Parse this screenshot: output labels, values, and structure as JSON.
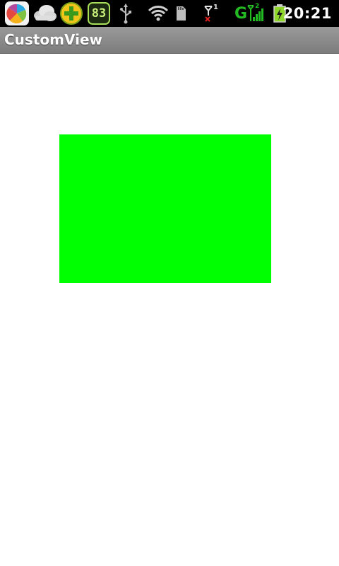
{
  "status_bar": {
    "time": "20:21",
    "notification_icons": [
      "pinwheel-app-icon",
      "cloud-weather-icon",
      "plus-app-icon",
      "counter-83-icon"
    ],
    "counter_value": "83",
    "system_icons": [
      "usb-icon",
      "wifi-icon",
      "sd-card-icon",
      "signal-off-icon",
      "gprs-signal-icon",
      "battery-charging-icon"
    ],
    "network_type": "G",
    "sim_slot_1": "1",
    "sim_slot_2": "2"
  },
  "title_bar": {
    "title": "CustomView"
  },
  "content": {
    "rect_color": "#00ff00"
  },
  "colors": {
    "status_bar_bg": "#000000",
    "title_bar_bg": "#8a8a8a",
    "content_bg": "#ffffff",
    "accent_green": "#00ff00"
  }
}
